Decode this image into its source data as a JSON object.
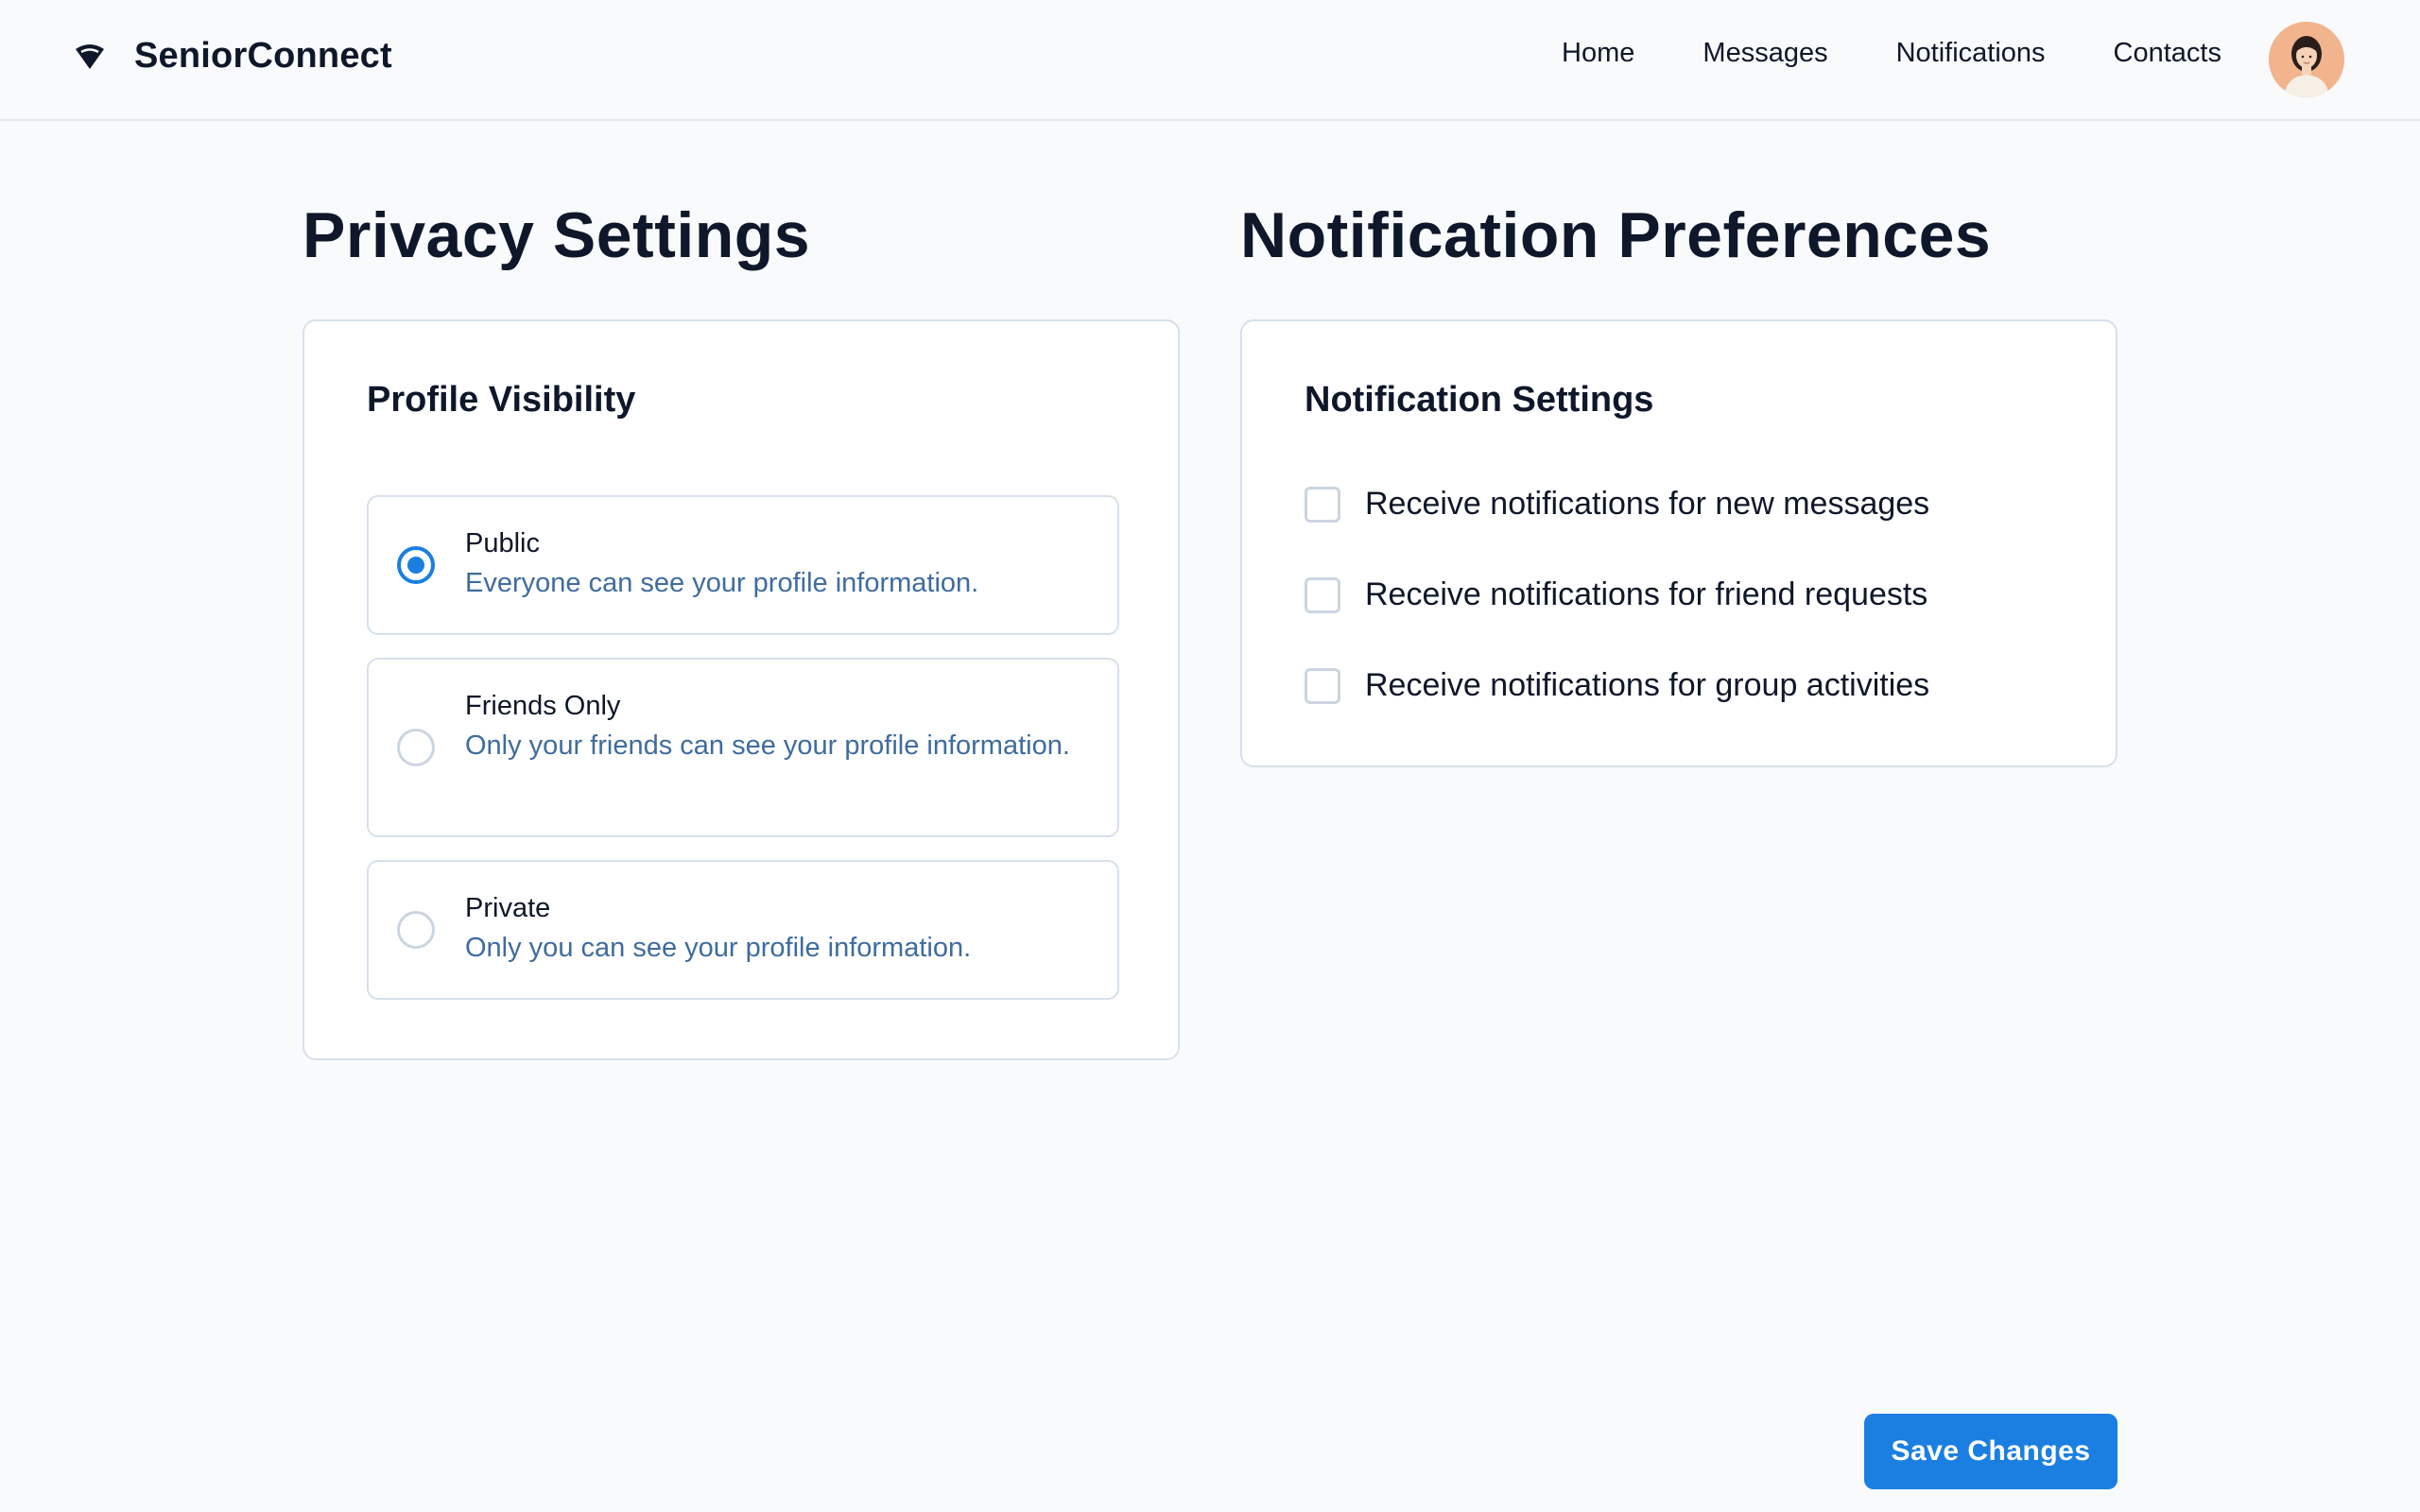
{
  "header": {
    "brand_icon": "wifi-signal-icon",
    "app_name": "SeniorConnect",
    "nav": [
      "Home",
      "Messages",
      "Notifications",
      "Contacts"
    ],
    "avatar_icon": "user-avatar"
  },
  "privacy": {
    "title": "Privacy Settings",
    "card_heading": "Profile Visibility",
    "options": [
      {
        "label": "Public",
        "description": "Everyone can see your profile information.",
        "selected": true
      },
      {
        "label": "Friends Only",
        "description": "Only your friends can see your profile information.",
        "selected": false
      },
      {
        "label": "Private",
        "description": "Only you can see your profile information.",
        "selected": false
      }
    ]
  },
  "notifications": {
    "title": "Notification Preferences",
    "card_heading": "Notification Settings",
    "items": [
      {
        "label": "Receive notifications for new messages",
        "checked": false
      },
      {
        "label": "Receive notifications for friend requests",
        "checked": false
      },
      {
        "label": "Receive notifications for group activities",
        "checked": false
      }
    ]
  },
  "actions": {
    "save_label": "Save Changes"
  },
  "colors": {
    "accent": "#1a7fe0",
    "description_text": "#3f6c9e",
    "background": "#f8fafc",
    "border": "#d7e0ec"
  }
}
